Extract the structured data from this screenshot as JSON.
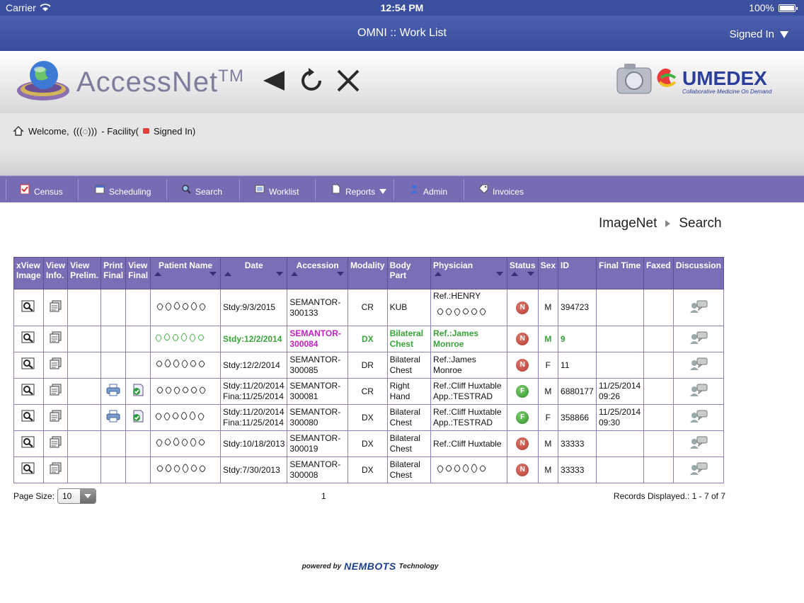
{
  "statusbar": {
    "carrier": "Carrier",
    "time": "12:54 PM",
    "battery": "100%"
  },
  "navbar": {
    "title": "OMNI :: Work List",
    "signed_in": "Signed In"
  },
  "banner": {
    "app_name": "AccessNet",
    "trademark": "TM"
  },
  "welcome": {
    "prefix": "Welcome,",
    "user": "(((◌)))",
    "facility": "- Facility(",
    "signed": "Signed In)"
  },
  "menu": {
    "items": [
      {
        "label": "Census"
      },
      {
        "label": "Scheduling"
      },
      {
        "label": "Search"
      },
      {
        "label": "Worklist"
      },
      {
        "label": "Reports"
      },
      {
        "label": "Admin"
      },
      {
        "label": "Invoices"
      }
    ]
  },
  "breadcrumb": {
    "root": "ImageNet",
    "current": "Search"
  },
  "table": {
    "headers": {
      "xview": "xView Image",
      "view_info": "View Info.",
      "view_prelim": "View Prelim.",
      "print_final": "Print Final",
      "view_final": "View Final",
      "patient_name": "Patient Name",
      "date": "Date",
      "accession": "Accession",
      "modality": "Modality",
      "body_part": "Body Part",
      "physician": "Physician",
      "status": "Status",
      "sex": "Sex",
      "id": "ID",
      "final_time": "Final Time",
      "faxed": "Faxed",
      "discussion": "Discussion"
    },
    "rows": [
      {
        "date": "Stdy:9/3/2015",
        "date2": "",
        "accession": "SEMANTOR-300133",
        "modality": "CR",
        "body_part": "KUB",
        "physician": "Ref.:HENRY",
        "physician2": "",
        "status": "N",
        "sex": "M",
        "id": "394723",
        "final_time": "",
        "final_time2": ""
      },
      {
        "date": "Stdy:12/2/2014",
        "date2": "",
        "accession": "SEMANTOR-300084",
        "modality": "DX",
        "body_part": "Bilateral Chest",
        "physician": "Ref.:James Monroe",
        "physician2": "",
        "status": "N",
        "sex": "M",
        "id": "9",
        "final_time": "",
        "final_time2": ""
      },
      {
        "date": "Stdy:12/2/2014",
        "date2": "",
        "accession": "SEMANTOR-300085",
        "modality": "DR",
        "body_part": "Bilateral Chest",
        "physician": "Ref.:James Monroe",
        "physician2": "",
        "status": "N",
        "sex": "F",
        "id": "11",
        "final_time": "",
        "final_time2": ""
      },
      {
        "date": "Stdy:11/20/2014",
        "date2": "Fina:11/25/2014",
        "accession": "SEMANTOR-300081",
        "modality": "CR",
        "body_part": "Right Hand",
        "physician": "Ref.:Cliff Huxtable",
        "physician2": "App.:TESTRAD",
        "status": "F",
        "sex": "M",
        "id": "6880177",
        "final_time": "11/25/2014",
        "final_time2": "09:26"
      },
      {
        "date": "Stdy:11/20/2014",
        "date2": "Fina:11/25/2014",
        "accession": "SEMANTOR-300080",
        "modality": "DX",
        "body_part": "Bilateral Chest",
        "physician": "Ref.:Cliff Huxtable",
        "physician2": "App.:TESTRAD",
        "status": "F",
        "sex": "F",
        "id": "358866",
        "final_time": "11/25/2014",
        "final_time2": "09:30"
      },
      {
        "date": "Stdy:10/18/2013",
        "date2": "",
        "accession": "SEMANTOR-300019",
        "modality": "DX",
        "body_part": "Bilateral Chest",
        "physician": "Ref.:Cliff Huxtable",
        "physician2": "",
        "status": "N",
        "sex": "M",
        "id": "33333",
        "final_time": "",
        "final_time2": ""
      },
      {
        "date": "Stdy:7/30/2013",
        "date2": "",
        "accession": "SEMANTOR-300008",
        "modality": "DX",
        "body_part": "Bilateral Chest",
        "physician": "",
        "physician2": "",
        "status": "N",
        "sex": "M",
        "id": "33333",
        "final_time": "",
        "final_time2": ""
      }
    ]
  },
  "pager": {
    "page_size_label": "Page Size:",
    "page_size": "10",
    "page": "1",
    "records": "Records Displayed.: 1 - 7 of 7"
  },
  "footer": {
    "powered": "powered by",
    "brand": "NEMBOTS",
    "tech": "Technology"
  },
  "colors": {
    "header_blue": "#3a4f9e",
    "menu_purple": "#776cb4",
    "status_n": "#b33a30",
    "status_f": "#2f8f2a"
  }
}
